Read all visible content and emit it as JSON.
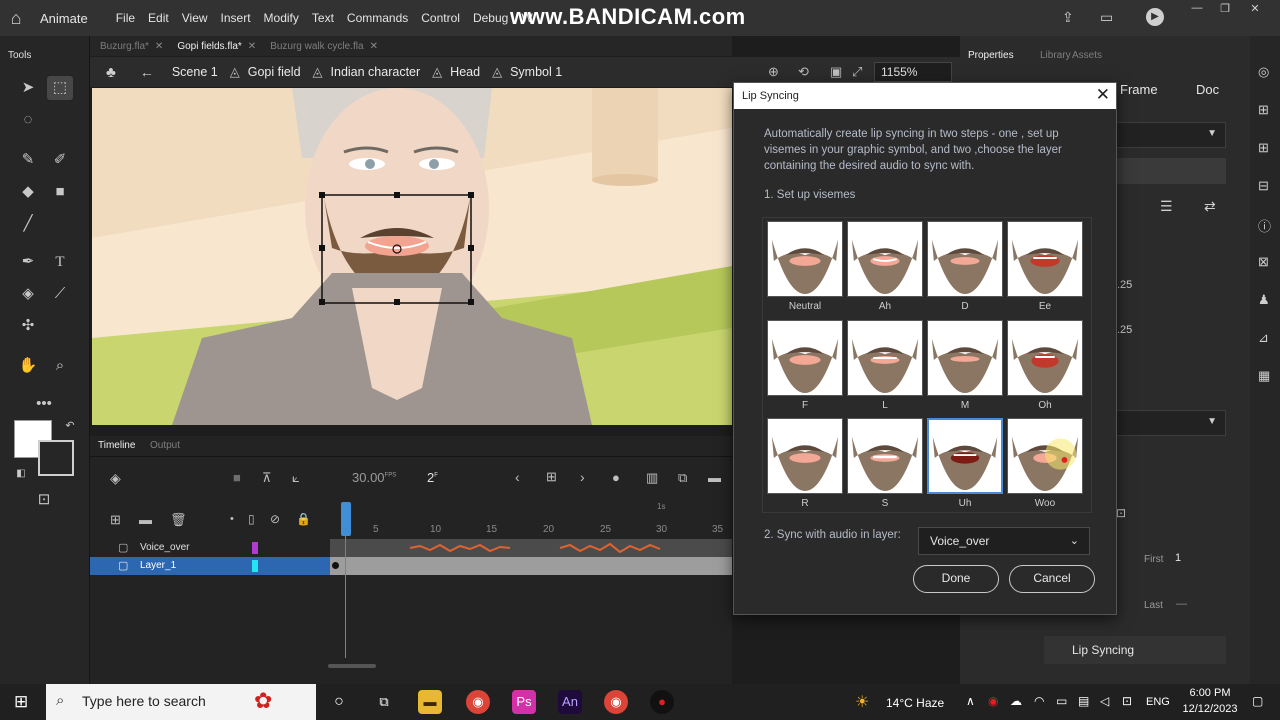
{
  "menubar": {
    "app_name": "Animate",
    "menus": [
      "File",
      "Edit",
      "View",
      "Insert",
      "Modify",
      "Text",
      "Commands",
      "Control",
      "Debug",
      "W"
    ],
    "watermark": "www.BANDICAM.com"
  },
  "tools_label": "Tools",
  "doc_tabs": [
    {
      "label": "Buzurg.fla*",
      "active": false
    },
    {
      "label": "Gopi fields.fla*",
      "active": true
    },
    {
      "label": "Buzurg walk cycle.fla",
      "active": false
    }
  ],
  "breadcrumb": [
    "Scene 1",
    "Gopi field",
    "Indian character",
    "Head",
    "Symbol 1"
  ],
  "zoom": "1155%",
  "timeline": {
    "tabs": [
      "Timeline",
      "Output"
    ],
    "fps": "30.00",
    "fps_unit": "FPS",
    "frame": "2",
    "frame_unit": "F",
    "ruler": [
      "1s",
      "5",
      "10",
      "15",
      "20",
      "25",
      "30",
      "35"
    ],
    "layers": [
      {
        "name": "Voice_over",
        "color": "#b13bd1",
        "selected": false
      },
      {
        "name": "Layer_1",
        "color": "#25e3f2",
        "selected": true
      }
    ]
  },
  "properties": {
    "tabs": [
      "Properties",
      "Library",
      "Assets"
    ],
    "sub_tabs": [
      "Frame",
      "Doc"
    ],
    "values": [
      ".25",
      ".25"
    ],
    "first_label": "First",
    "first_value": "1",
    "last_label": "Last",
    "last_value": "—",
    "lip_sync_button": "Lip Syncing"
  },
  "dialog": {
    "title": "Lip Syncing",
    "description": "Automatically create lip syncing in two steps - one , set up visemes in your graphic symbol, and two ,choose the layer containing the desired audio to sync with.",
    "step1": "1. Set up visemes",
    "visemes": [
      "Neutral",
      "Ah",
      "D",
      "Ee",
      "F",
      "L",
      "M",
      "Oh",
      "R",
      "S",
      "Uh",
      "Woo"
    ],
    "selected_viseme": "Uh",
    "step2": "2. Sync with audio in layer:",
    "audio_layer": "Voice_over",
    "done": "Done",
    "cancel": "Cancel"
  },
  "taskbar": {
    "search_placeholder": "Type here to search",
    "weather": "14°C  Haze",
    "lang": "ENG",
    "time": "6:00 PM",
    "date": "12/12/2023"
  }
}
